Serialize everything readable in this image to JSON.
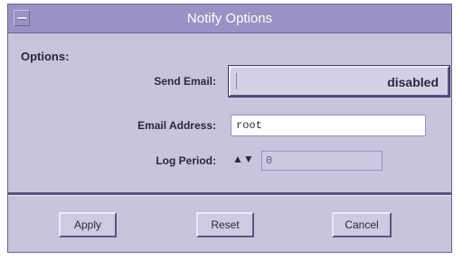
{
  "window": {
    "title": "Notify Options"
  },
  "options": {
    "label": "Options:"
  },
  "send_email": {
    "label": "Send Email:",
    "value": "disabled"
  },
  "email_address": {
    "label": "Email Address:",
    "value": "root"
  },
  "log_period": {
    "label": "Log Period:",
    "spin_glyph": "▲▼",
    "value": "0"
  },
  "buttons": {
    "apply": "Apply",
    "reset": "Reset",
    "cancel": "Cancel"
  },
  "colors": {
    "titlebar": "#9a91c4",
    "window_bg": "#c9c3de",
    "separator": "#5a5480"
  }
}
